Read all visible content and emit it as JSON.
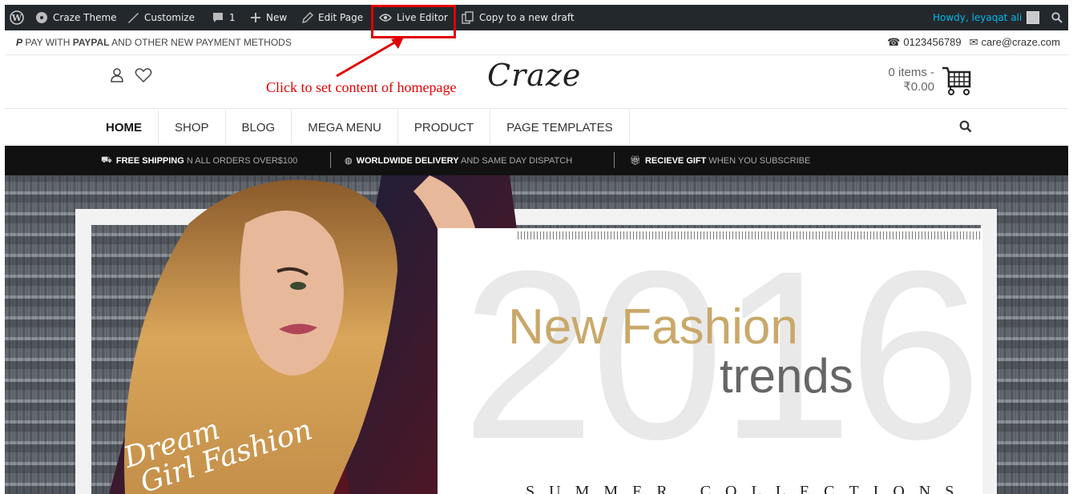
{
  "adminbar": {
    "site_name": "Craze Theme",
    "customize": "Customize",
    "comments_count": "1",
    "new": "New",
    "edit_page": "Edit Page",
    "live_editor": "Live Editor",
    "copy_draft": "Copy to a new draft",
    "howdy": "Howdy, leyaqat ali"
  },
  "topinfo": {
    "pay_prefix": "PAY WITH ",
    "pay_brand": "PAYPAL",
    "pay_suffix": " AND OTHER NEW PAYMENT METHODS",
    "phone": "0123456789",
    "email": "care@craze.com"
  },
  "header": {
    "annotation": "Click to set content of homepage",
    "logo": "Craze",
    "cart_items": "0 items -",
    "cart_total": "₹0.00"
  },
  "nav": {
    "items": [
      "HOME",
      "SHOP",
      "BLOG",
      "MEGA MENU",
      "PRODUCT",
      "PAGE TEMPLATES"
    ]
  },
  "promo": {
    "free_shipping_bold": "FREE SHIPPING",
    "free_shipping_rest": " N ALL ORDERS OVER$100",
    "worldwide_bold": "WORLDWIDE DELIVERY",
    "worldwide_rest": " AND SAME DAY DISPATCH",
    "gift_bold": "RECIEVE GIFT",
    "gift_rest": " WHEN YOU SUBSCRIBE"
  },
  "hero": {
    "year": "2016",
    "headline": "New Fashion",
    "subheadline": "trends",
    "collection": "SUMMER COLLECTIONS",
    "script_line1": "Dream",
    "script_line2": "Girl Fashion"
  },
  "colors": {
    "adminbar_bg": "#23282d",
    "howdy": "#00b9eb",
    "annotation_red": "#e30000",
    "gold": "#c9a86a"
  }
}
